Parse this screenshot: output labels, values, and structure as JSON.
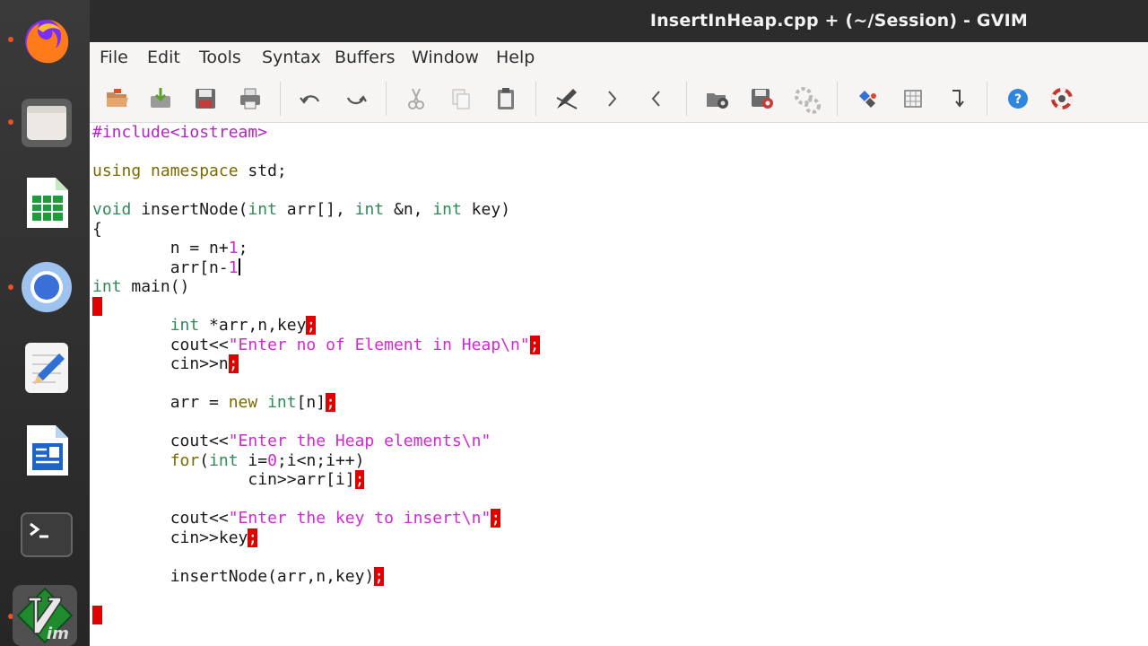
{
  "window": {
    "title": "InsertInHeap.cpp + (~/Session) - GVIM"
  },
  "menu": [
    "File",
    "Edit",
    "Tools",
    "Syntax",
    "Buffers",
    "Window",
    "Help"
  ],
  "toolbar": {
    "icons": [
      "open-icon",
      "save-download-icon",
      "save-icon",
      "print-icon",
      "undo-icon",
      "redo-icon",
      "cut-icon",
      "copy-icon",
      "paste-icon",
      "find-replace-icon",
      "find-next-icon",
      "find-prev-icon",
      "load-session-icon",
      "save-session-icon",
      "run-script-icon",
      "make-icon",
      "shell-icon",
      "jump-tag-icon",
      "help-icon",
      "find-help-icon"
    ]
  },
  "dock": [
    "Firefox",
    "Files",
    "LibreOffice Calc",
    "Chromium",
    "Text Editor",
    "LibreOffice Writer",
    "Terminal",
    "GVIM"
  ],
  "code": {
    "l01": "#include<iostream>",
    "l03a": "using",
    "l03b": "namespace",
    "l03c": " std;",
    "l05a": "void",
    "l05b": " insertNode(",
    "l05c": "int",
    "l05d": " arr[], ",
    "l05e": "int",
    "l05f": " &n, ",
    "l05g": "int",
    "l05h": " key)",
    "l06": "{",
    "l07a": "        n = n+",
    "l07b": "1",
    "l07c": ";",
    "l08a": "        arr[n-",
    "l08b": "1",
    "l09a": "int",
    "l09b": " main()",
    "l10": "{",
    "l11a": "        ",
    "l11b": "int",
    "l11c": " *arr,n,key",
    "l11d": ";",
    "l12a": "        cout<<",
    "l12b": "\"Enter no of Element in Heap\\n\"",
    "l12c": ";",
    "l13a": "        cin>>n",
    "l13b": ";",
    "l15a": "        arr = ",
    "l15b": "new",
    "l15c": " ",
    "l15d": "int",
    "l15e": "[n]",
    "l15f": ";",
    "l17a": "        cout<<",
    "l17b": "\"Enter the Heap elements\\n\"",
    "l18a": "        ",
    "l18b": "for",
    "l18c": "(",
    "l18d": "int",
    "l18e": " i=",
    "l18f": "0",
    "l18g": ";i<n;i++)",
    "l19a": "                cin>>arr[i]",
    "l19b": ";",
    "l21a": "        cout<<",
    "l21b": "\"Enter the key to insert\\n\"",
    "l21c": ";",
    "l22a": "        cin>>key",
    "l22b": ";",
    "l24a": "        insertNode(arr,n,key)",
    "l24b": ";",
    "l26": "}"
  },
  "colors": {
    "preproc": "#b524c5",
    "keyword": "#7a6a00",
    "type": "#2e8b57",
    "string": "#d627d6",
    "error": "#e00000"
  }
}
